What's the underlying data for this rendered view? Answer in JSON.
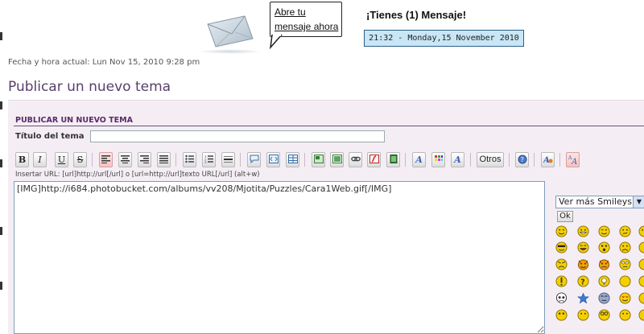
{
  "header": {
    "bubble_line1": "Abre tu",
    "bubble_line2": "mensaje ahora",
    "message_title": "¡Tienes (1) Mensaje!",
    "clock": "21:32 - Monday,15 November 2010"
  },
  "datetime": "Fecha y hora actual: Lun Nov 15, 2010 9:28 pm",
  "page_title": "Publicar un nuevo tema",
  "form": {
    "section_heading": "PUBLICAR UN NUEVO TEMA",
    "topic_label": "Título del tema",
    "topic_value": "",
    "toolbar": {
      "bold": "B",
      "italic": "I",
      "underline": "U",
      "strike": "S",
      "others": "Otros"
    },
    "url_hint": "Insertar URL: [url]http://url[/url] o [url=http://url]texto URL[/url] (alt+w)",
    "body_value": "[IMG]http://i684.photobucket.com/albums/vv208/Mjotita/Puzzles/Cara1Web.gif[/IMG]"
  },
  "smileys": {
    "select_value": "Ver más Smileys",
    "ok_label": "Ok"
  },
  "colors": {
    "accent_purple": "#5a3e6b",
    "panel_bg": "#f4eef4",
    "clock_bg": "#c8e6f5"
  }
}
